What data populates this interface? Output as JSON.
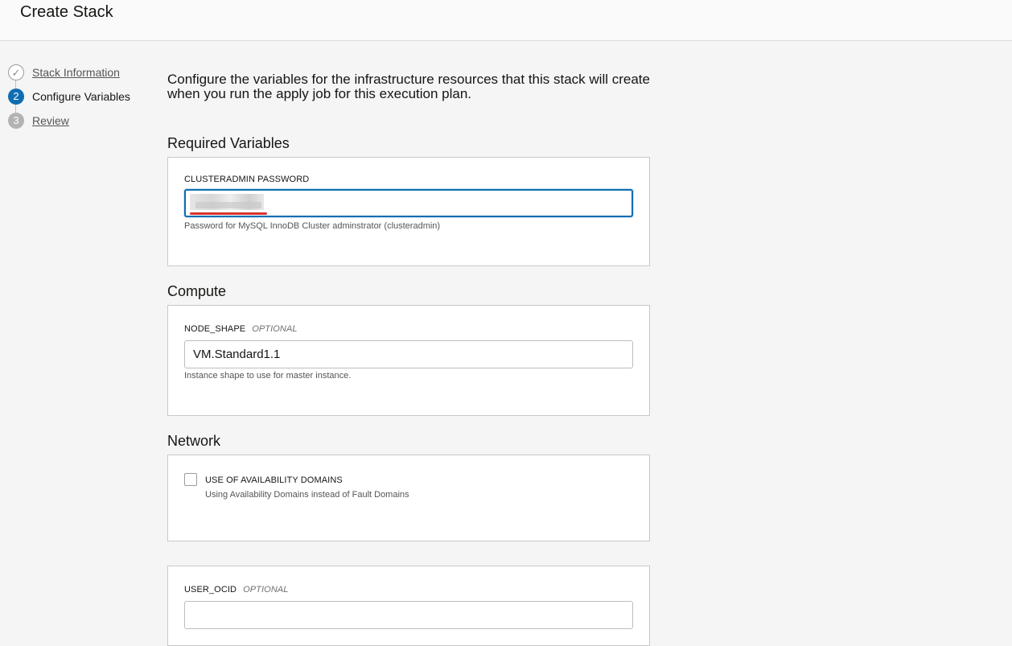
{
  "header": {
    "title": "Create Stack"
  },
  "steps": [
    {
      "number": "✓",
      "label": "Stack Information",
      "state": "done"
    },
    {
      "number": "2",
      "label": "Configure Variables",
      "state": "active"
    },
    {
      "number": "3",
      "label": "Review",
      "state": "todo"
    }
  ],
  "intro": "Configure the variables for the infrastructure resources that this stack will create when you run the apply job for this execution plan.",
  "sections": {
    "required": {
      "title": "Required Variables",
      "password": {
        "label": "CLUSTERADMIN PASSWORD",
        "hint": "Password for MySQL InnoDB Cluster adminstrator (clusteradmin)"
      }
    },
    "compute": {
      "title": "Compute",
      "node_shape": {
        "label": "NODE_SHAPE",
        "optional": "OPTIONAL",
        "value": "VM.Standard1.1",
        "hint": "Instance shape to use for master instance."
      }
    },
    "network": {
      "title": "Network",
      "availability": {
        "label": "USE OF AVAILABILITY DOMAINS",
        "hint": "Using Availability Domains instead of Fault Domains",
        "checked": false
      }
    },
    "user": {
      "user_ocid": {
        "label": "USER_OCID",
        "optional": "OPTIONAL",
        "value": ""
      }
    }
  },
  "colors": {
    "accent": "#0f6db2",
    "error_underline": "#d9322b"
  }
}
